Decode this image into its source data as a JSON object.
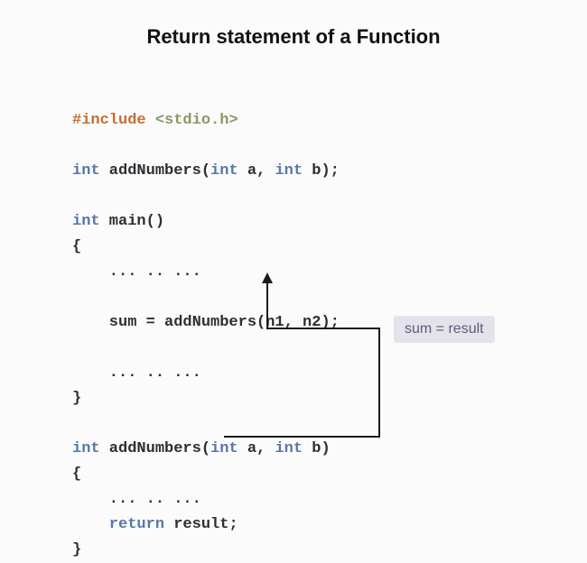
{
  "title": "Return statement of a Function",
  "code": {
    "l1_include": "#include",
    "l1_header": "<stdio.h>",
    "l2_kw_int_1": "int",
    "l2_fn": " addNumbers(",
    "l2_kw_int_2": "int",
    "l2_a": " a, ",
    "l2_kw_int_3": "int",
    "l2_b": " b);",
    "l3_kw_int": "int",
    "l3_main": " main()",
    "l4_open": "{",
    "l5_dots": "    ... .. ...",
    "l6_blank": "",
    "l7_call": "    sum = addNumbers(n1, n2);",
    "l8_blank": "",
    "l9_dots": "    ... .. ...",
    "l10_close": "}",
    "l11_kw_int_1": "int",
    "l11_fn": " addNumbers(",
    "l11_kw_int_2": "int",
    "l11_a": " a, ",
    "l11_kw_int_3": "int",
    "l11_b": " b)",
    "l12_open": "{",
    "l13_dots": "    ... .. ...",
    "l14_ret_kw": "    return",
    "l14_ret_v": " result;",
    "l15_close": "}"
  },
  "callout": "sum = result"
}
